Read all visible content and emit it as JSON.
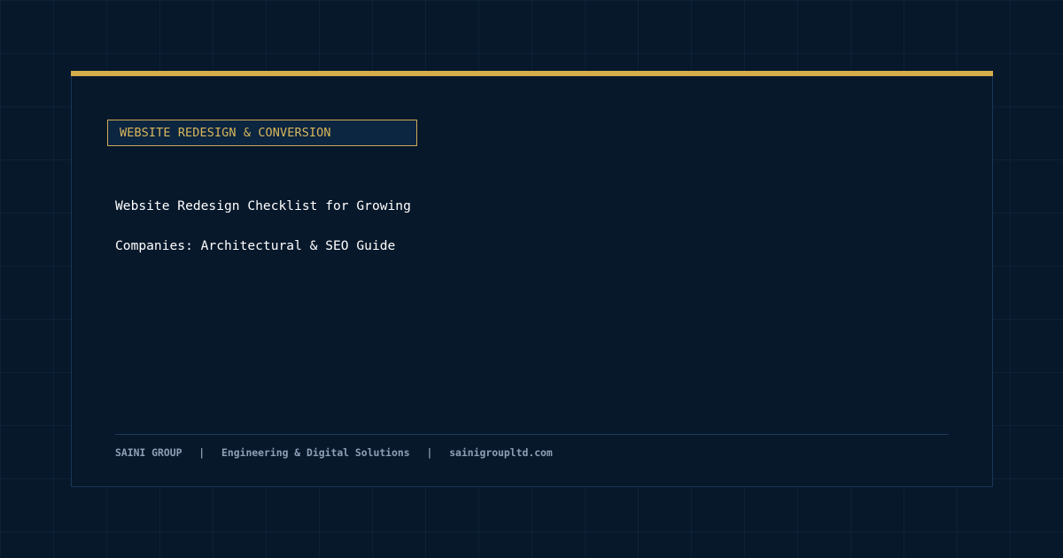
{
  "category": "WEBSITE REDESIGN & CONVERSION",
  "title": {
    "line1": "Website Redesign Checklist for Growing",
    "line2": "Companies: Architectural & SEO Guide"
  },
  "footer": {
    "brand": "SAINI GROUP",
    "separator": "|",
    "tagline": "Engineering & Digital Solutions",
    "website": "sainigroupltd.com"
  },
  "colors": {
    "background": "#07182b",
    "accent": "#d4ac4c",
    "title_text": "#ffffff",
    "footer_text": "#8f9fb5"
  }
}
